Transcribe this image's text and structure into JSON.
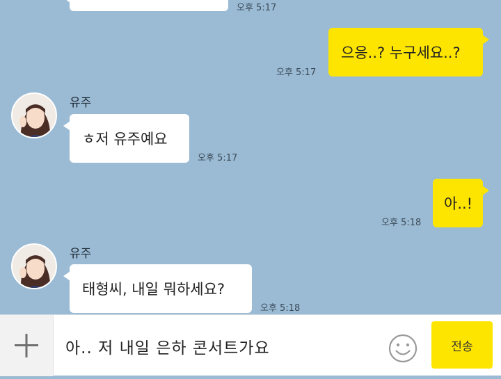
{
  "messages": {
    "top_partial": {
      "time": "오후 5:17"
    },
    "m1": {
      "text": "으응..? 누구세요..?",
      "time": "오후 5:17"
    },
    "m2": {
      "sender": "유주",
      "text": "ㅎ저 유주예요",
      "time": "오후 5:17"
    },
    "m3": {
      "text": "아..!",
      "time": "오후 5:18"
    },
    "m4": {
      "sender": "유주",
      "text": "태형씨, 내일 뭐하세요?",
      "time": "오후 5:18"
    }
  },
  "composer": {
    "value": "아.. 저 내일 은하 콘서트가요",
    "send_label": "전송",
    "plus_icon": "plus-icon",
    "emoji_icon": "smiley-icon"
  },
  "colors": {
    "background": "#9bbbd4",
    "my_bubble": "#fee500",
    "their_bubble": "#ffffff"
  }
}
